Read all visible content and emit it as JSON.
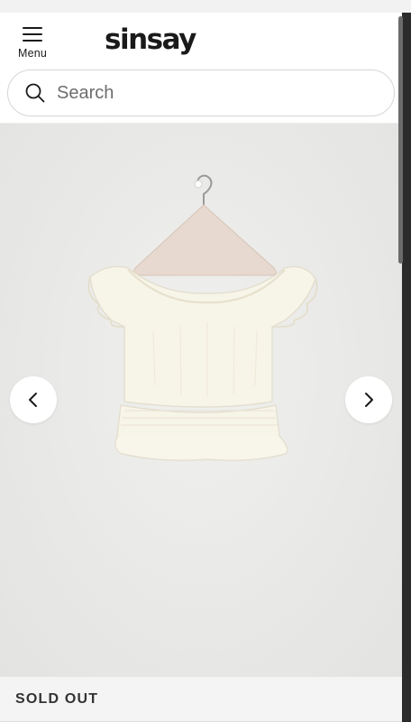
{
  "header": {
    "menu_label": "Menu",
    "logo_text": "sinsay"
  },
  "search": {
    "placeholder": "Search",
    "value": ""
  },
  "gallery": {
    "image_alt": "White ruffled off-shoulder crop top on a hanger",
    "prev_icon": "chevron-left-icon",
    "next_icon": "chevron-right-icon"
  },
  "product": {
    "availability": "SOLD OUT"
  },
  "colors": {
    "text": "#1a1a1a",
    "gallery_bg": "#e8e8e6",
    "status_bg": "#f4f4f4"
  }
}
